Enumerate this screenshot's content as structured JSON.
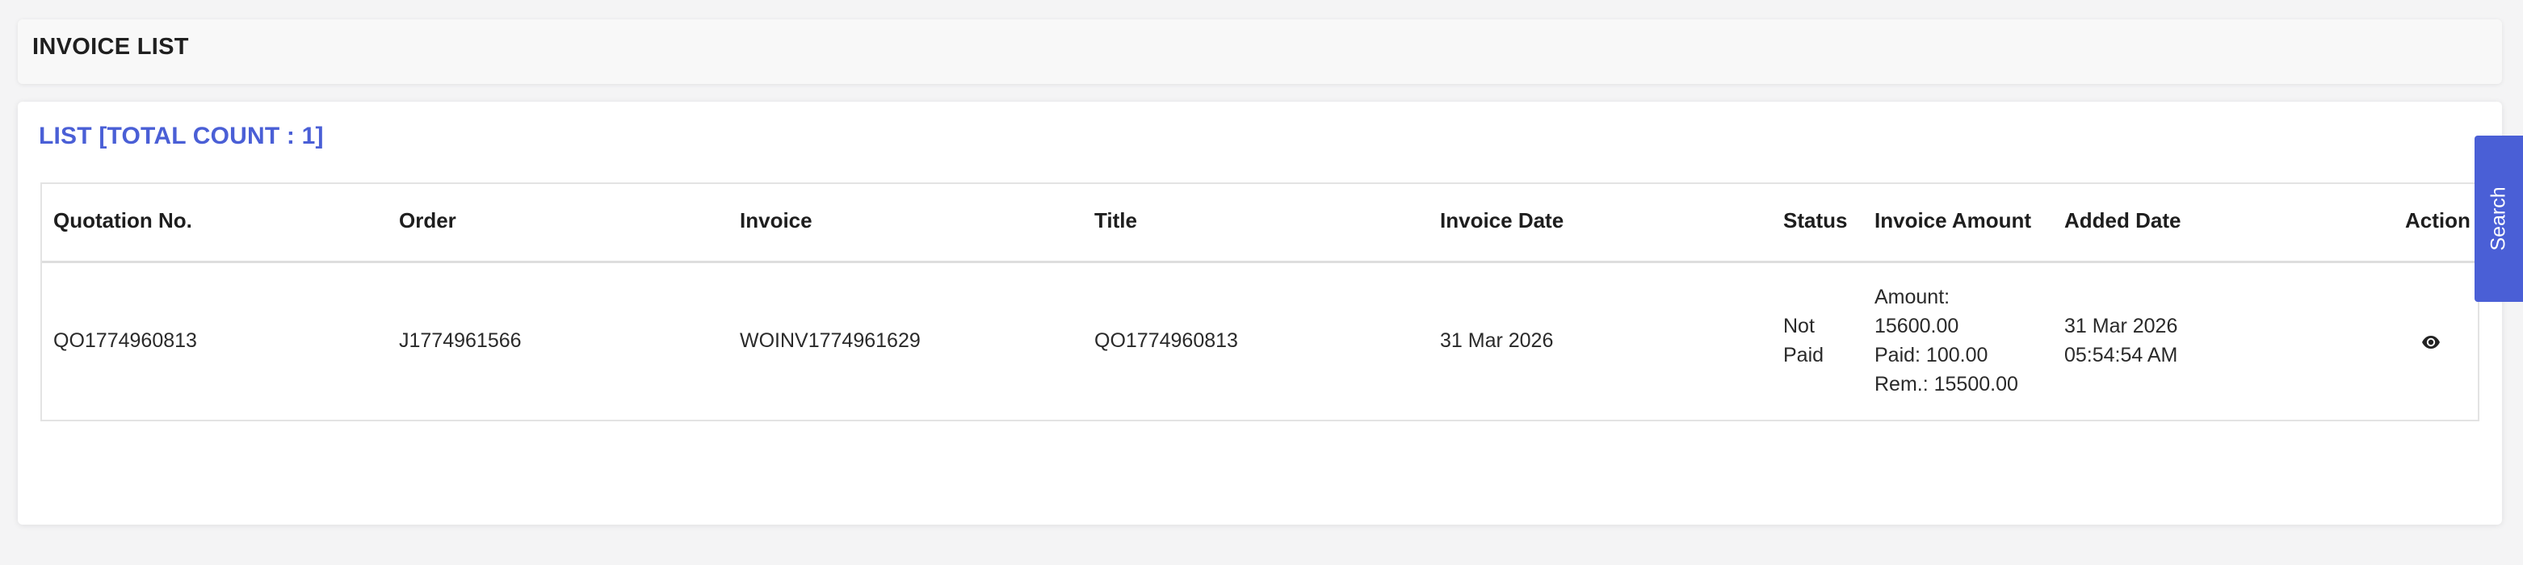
{
  "header": {
    "title": "INVOICE LIST"
  },
  "list": {
    "title": "LIST [TOTAL COUNT : 1]"
  },
  "table": {
    "columns": [
      "Quotation No.",
      "Order",
      "Invoice",
      "Title",
      "Invoice Date",
      "Status",
      "Invoice Amount",
      "Added Date",
      "Action"
    ],
    "rows": [
      {
        "quotation_no": "QO1774960813",
        "order": "J1774961566",
        "invoice": "WOINV1774961629",
        "title": "QO1774960813",
        "invoice_date": "31 Mar 2026",
        "status_line_1": "Not",
        "status_line_2": "Paid",
        "amount_line_1": "Amount:",
        "amount_line_2": "15600.00",
        "amount_line_3": "Paid: 100.00",
        "amount_line_4": "Rem.: 15500.00",
        "added_date_line_1": "31 Mar 2026",
        "added_date_line_2": "05:54:54 AM",
        "action_icon": "eye-icon"
      }
    ]
  },
  "search_tab": {
    "label": "Search"
  },
  "colors": {
    "accent": "#4a5fd6",
    "title_text": "#1f1f1f",
    "table_border": "#e3e3e3"
  }
}
